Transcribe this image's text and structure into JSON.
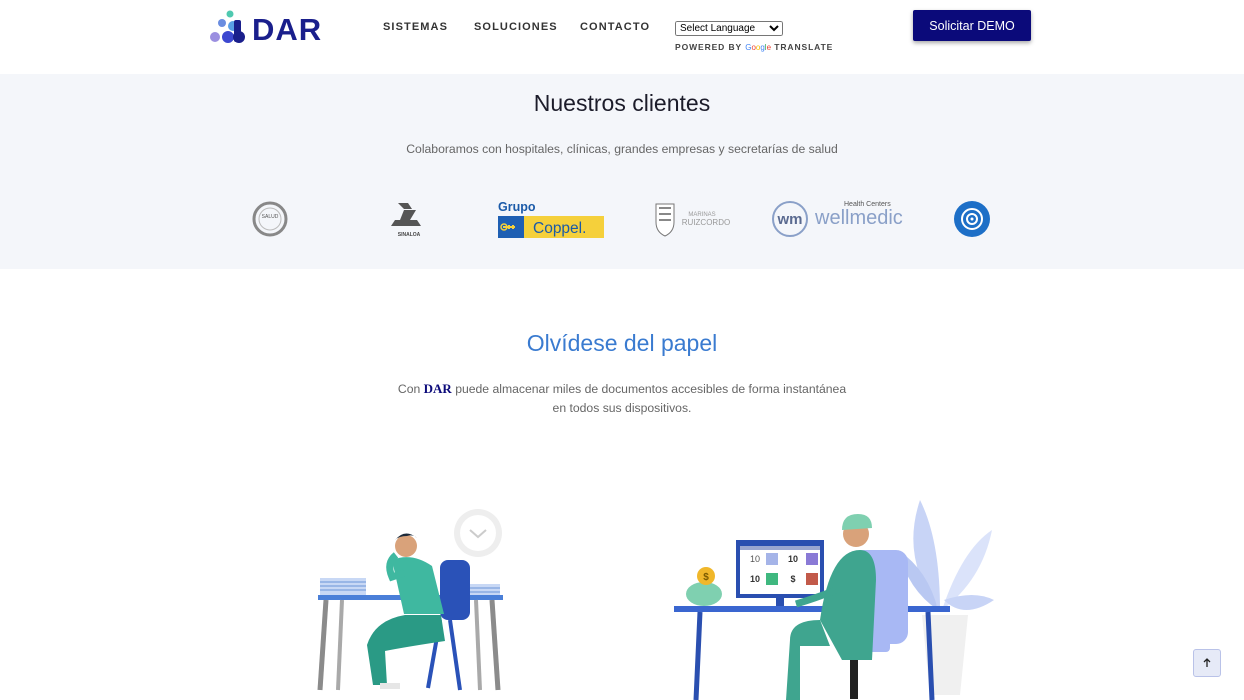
{
  "brand": {
    "name": "DAR",
    "accent": "#1a1f8c",
    "button_color": "#0b0a7a"
  },
  "nav": [
    {
      "label": "SISTEMAS"
    },
    {
      "label": "SOLUCIONES"
    },
    {
      "label": "CONTACTO"
    }
  ],
  "language": {
    "selected": "Select Language",
    "powered_by": "POWERED BY",
    "google": "Google",
    "translate": "TRANSLATE"
  },
  "header": {
    "demo_label": "Solicitar DEMO"
  },
  "clients": {
    "title": "Nuestros clientes",
    "subtitle": "Colaboramos con hospitales, clínicas, grandes empresas y secretarías de salud",
    "logos": [
      {
        "name": "salud-logo",
        "text": "SALUD"
      },
      {
        "name": "servicios-salud-sinaloa-logo",
        "text": "SINALOA"
      },
      {
        "name": "grupo-coppel-logo",
        "line1": "Grupo",
        "line2": "Coppel."
      },
      {
        "name": "marinas-logo",
        "line1": "MARINAS",
        "line2": "RUIZCORDO"
      },
      {
        "name": "wellmedic-logo",
        "mark": "wm",
        "small": "Health Centers",
        "text": "wellmedic"
      },
      {
        "name": "circle-logo"
      }
    ]
  },
  "paper": {
    "title": "Olvídese del papel",
    "text_prefix": "Con ",
    "text_brand": "DAR",
    "text_rest": " puede almacenar miles de documentos accesibles de forma instantánea en todos sus dispositivos."
  },
  "illustration": {
    "screen_values": [
      "10",
      "10",
      "10",
      "$"
    ],
    "coin": "$"
  },
  "scroll_top_icon": "arrow-up-icon"
}
